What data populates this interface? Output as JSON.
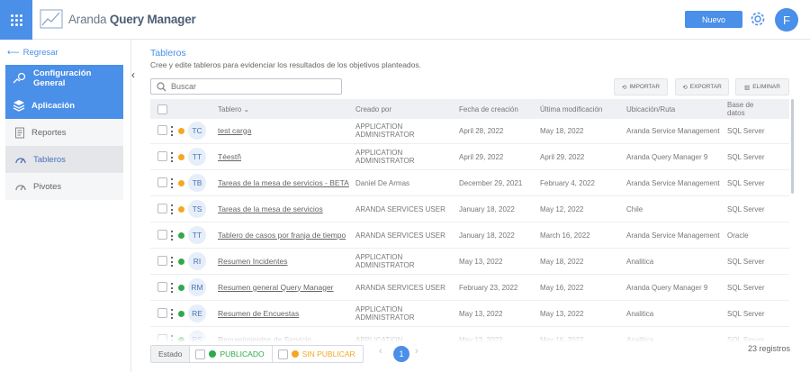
{
  "app": {
    "brand_light": "Aranda",
    "brand_bold": "Query Manager",
    "new_button": "Nuevo",
    "user_initial": "F",
    "accent": "#4a8fe8"
  },
  "sidebar": {
    "back": "Regresar",
    "items": [
      {
        "label": "Configuración General",
        "icon": "gear-hand-icon",
        "active": true
      },
      {
        "label": "Aplicación",
        "icon": "layers-icon",
        "active": true
      },
      {
        "label": "Reportes",
        "icon": "report-icon",
        "active": false
      },
      {
        "label": "Tableros",
        "icon": "dashboard-gauge-icon",
        "active": false,
        "selected": true
      },
      {
        "label": "Pivotes",
        "icon": "pivot-icon",
        "active": false
      }
    ]
  },
  "main": {
    "title": "Tableros",
    "subtitle": "Cree y edite tableros para evidenciar los resultados de los objetivos planteados.",
    "search_placeholder": "Buscar",
    "actions": {
      "import": "IMPORTAR",
      "export": "EXPORTAR",
      "delete": "ELIMINAR"
    }
  },
  "table": {
    "headers": {
      "name": "Tablero",
      "created_by": "Creado por",
      "created_date": "Fecha de creación",
      "modified_date": "Última modificación",
      "location": "Ubicación/Ruta",
      "database": "Base de datos"
    },
    "rows": [
      {
        "abbr": "TC",
        "name": "test carga",
        "created_by": "APPLICATION ADMINISTRATOR",
        "created": "April 28, 2022",
        "modified": "May 18, 2022",
        "location": "Aranda Service Management",
        "db": "SQL Server",
        "status": "unpublished"
      },
      {
        "abbr": "TT",
        "name": "Téestñ",
        "created_by": "APPLICATION ADMINISTRATOR",
        "created": "April 29, 2022",
        "modified": "April 29, 2022",
        "location": "Aranda Query Manager 9",
        "db": "SQL Server",
        "status": "unpublished"
      },
      {
        "abbr": "TB",
        "name": "Tareas de la mesa de servicios - BETA",
        "created_by": "Daniel De Armas",
        "created": "December 29, 2021",
        "modified": "February 4, 2022",
        "location": "Aranda Service Management",
        "db": "SQL Server",
        "status": "unpublished"
      },
      {
        "abbr": "TS",
        "name": "Tareas de la mesa de servicios",
        "created_by": "ARANDA SERVICES USER",
        "created": "January 18, 2022",
        "modified": "May 12, 2022",
        "location": "Chile",
        "db": "SQL Server",
        "status": "unpublished"
      },
      {
        "abbr": "TT",
        "name": "Tablero de casos por franja de tiempo",
        "created_by": "ARANDA SERVICES USER",
        "created": "January 18, 2022",
        "modified": "March 16, 2022",
        "location": "Aranda Service Management",
        "db": "Oracle",
        "status": "published"
      },
      {
        "abbr": "RI",
        "name": "Resumen Incidentes",
        "created_by": "APPLICATION ADMINISTRATOR",
        "created": "May 13, 2022",
        "modified": "May 18, 2022",
        "location": "Analitica",
        "db": "SQL Server",
        "status": "published"
      },
      {
        "abbr": "RM",
        "name": "Resumen general Query Manager",
        "created_by": "ARANDA SERVICES USER",
        "created": "February 23, 2022",
        "modified": "May 16, 2022",
        "location": "Aranda Query Manager 9",
        "db": "SQL Server",
        "status": "published"
      },
      {
        "abbr": "RE",
        "name": "Resumen de Encuestas",
        "created_by": "APPLICATION ADMINISTRATOR",
        "created": "May 13, 2022",
        "modified": "May 13, 2022",
        "location": "Analitica",
        "db": "SQL Server",
        "status": "published"
      },
      {
        "abbr": "RS",
        "name": "Requerimientos de Servicio",
        "created_by": "APPLICATION",
        "created": "May 13, 2022",
        "modified": "May 16, 2022",
        "location": "Analitica",
        "db": "SQL Server",
        "status": "published"
      }
    ],
    "status_colors": {
      "published": "#2eaa4a",
      "unpublished": "#f5a623"
    }
  },
  "footer": {
    "state_label": "Estado",
    "published_label": "PUBLICADO",
    "unpublished_label": "SIN PUBLICAR",
    "current_page": "1",
    "total": "23 registros"
  }
}
